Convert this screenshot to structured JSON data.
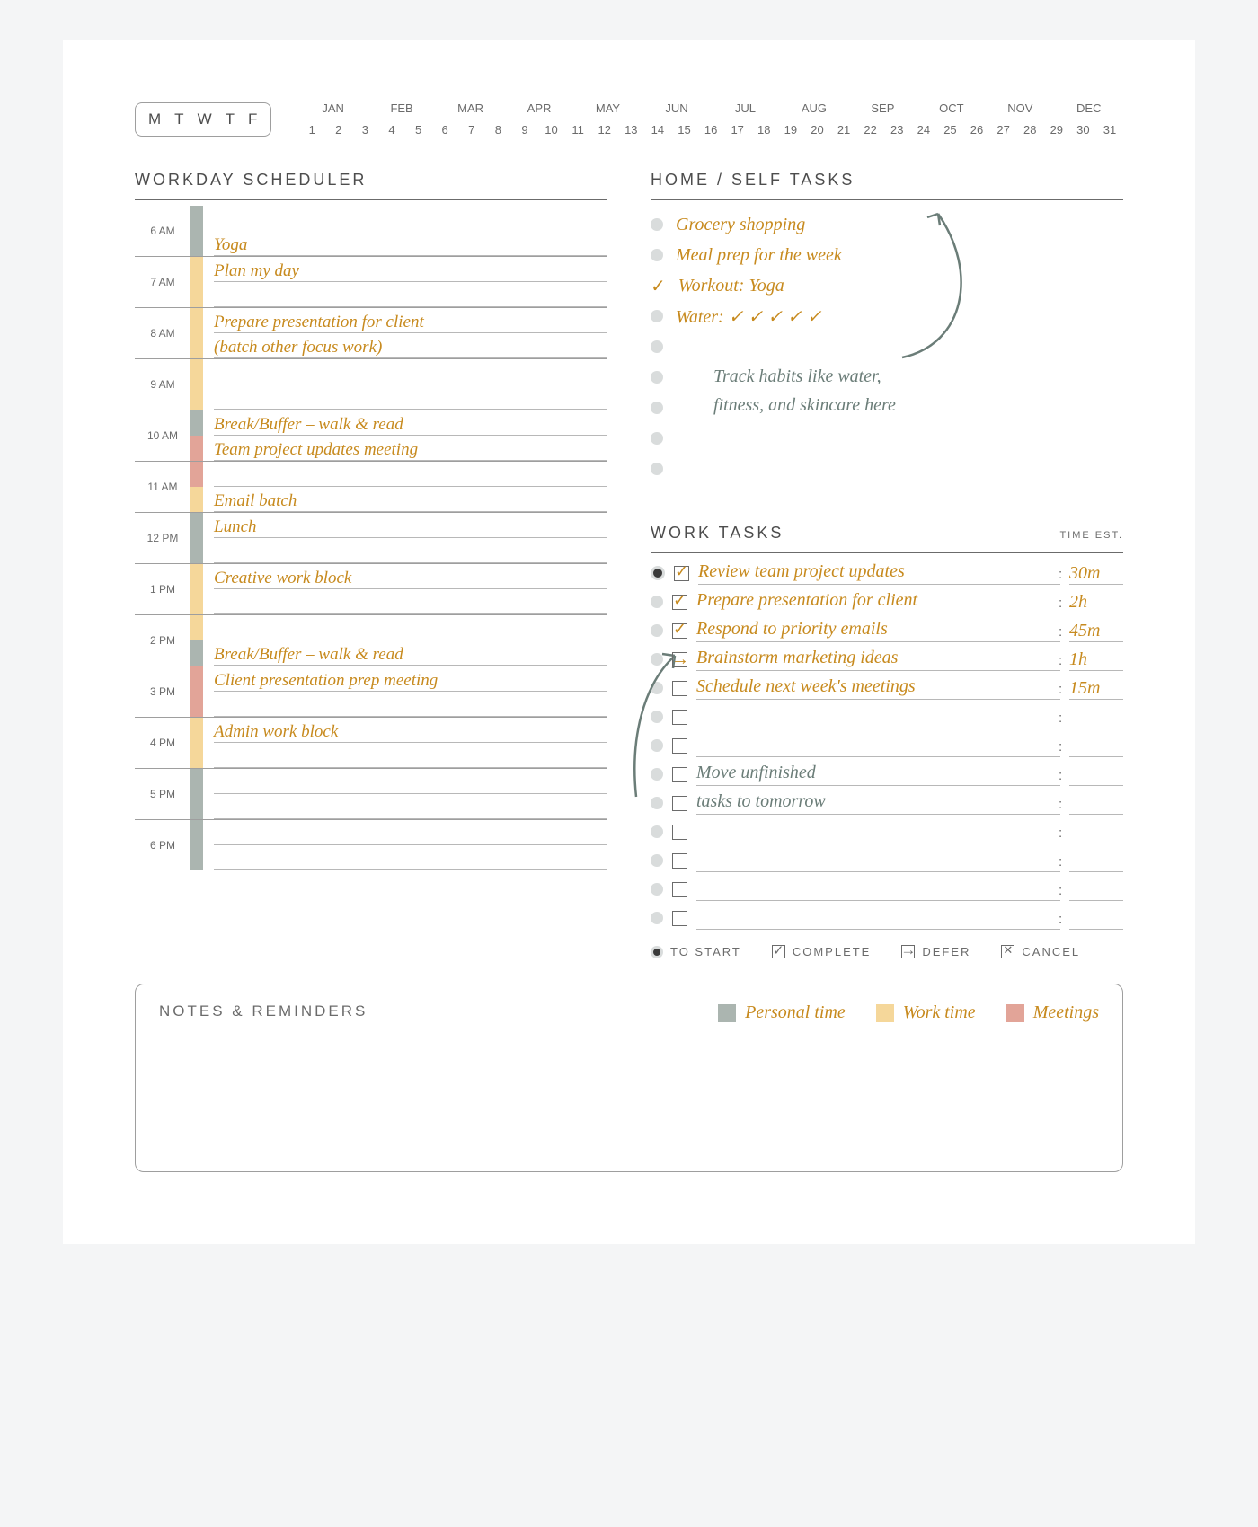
{
  "weekdays": [
    "M",
    "T",
    "W",
    "T",
    "F"
  ],
  "months": [
    "JAN",
    "FEB",
    "MAR",
    "APR",
    "MAY",
    "JUN",
    "JUL",
    "AUG",
    "SEP",
    "OCT",
    "NOV",
    "DEC"
  ],
  "days": [
    "1",
    "2",
    "3",
    "4",
    "5",
    "6",
    "7",
    "8",
    "9",
    "10",
    "11",
    "12",
    "13",
    "14",
    "15",
    "16",
    "17",
    "18",
    "19",
    "20",
    "21",
    "22",
    "23",
    "24",
    "25",
    "26",
    "27",
    "28",
    "29",
    "30",
    "31"
  ],
  "scheduler": {
    "title": "WORKDAY SCHEDULER",
    "hours": [
      {
        "label": "6 AM",
        "bars": [
          "g"
        ],
        "lines": [
          "Yoga"
        ],
        "single": true
      },
      {
        "label": "7 AM",
        "bars": [
          "s",
          "s"
        ],
        "lines": [
          "Plan my day",
          ""
        ]
      },
      {
        "label": "8 AM",
        "bars": [
          "s",
          "s"
        ],
        "lines": [
          "Prepare presentation for client",
          "(batch other focus work)"
        ]
      },
      {
        "label": "9 AM",
        "bars": [
          "s",
          "s"
        ],
        "lines": [
          "",
          ""
        ]
      },
      {
        "label": "10 AM",
        "bars": [
          "g",
          "r"
        ],
        "lines": [
          "Break/Buffer – walk & read",
          "Team project updates meeting"
        ]
      },
      {
        "label": "11 AM",
        "bars": [
          "r",
          "s"
        ],
        "lines": [
          "",
          "Email batch"
        ]
      },
      {
        "label": "12 PM",
        "bars": [
          "g",
          "g"
        ],
        "lines": [
          "Lunch",
          ""
        ]
      },
      {
        "label": "1 PM",
        "bars": [
          "s",
          "s"
        ],
        "lines": [
          "Creative work block",
          ""
        ]
      },
      {
        "label": "2 PM",
        "bars": [
          "s",
          "g"
        ],
        "lines": [
          "",
          "Break/Buffer – walk & read"
        ]
      },
      {
        "label": "3 PM",
        "bars": [
          "r",
          "r"
        ],
        "lines": [
          "Client presentation prep meeting",
          ""
        ]
      },
      {
        "label": "4 PM",
        "bars": [
          "s",
          "s"
        ],
        "lines": [
          "Admin work block",
          ""
        ]
      },
      {
        "label": "5 PM",
        "bars": [
          "g",
          "g"
        ],
        "lines": [
          "",
          ""
        ]
      },
      {
        "label": "6 PM",
        "bars": [
          "g",
          "g"
        ],
        "lines": [
          "",
          ""
        ]
      }
    ]
  },
  "home": {
    "title": "HOME / SELF TASKS",
    "items": [
      {
        "text": "Grocery shopping",
        "checked": false
      },
      {
        "text": "Meal prep for the week",
        "checked": false
      },
      {
        "text": "Workout: Yoga",
        "checked": true
      },
      {
        "text": "Water: ✓ ✓ ✓ ✓ ✓",
        "checked": false
      },
      {
        "text": "",
        "checked": false
      },
      {
        "text": "",
        "checked": false
      },
      {
        "text": "",
        "checked": false
      },
      {
        "text": "",
        "checked": false
      },
      {
        "text": "",
        "checked": false
      }
    ],
    "note": "Track habits like water, fitness, and skincare here"
  },
  "work": {
    "title": "WORK TASKS",
    "sub": "TIME EST.",
    "tasks": [
      {
        "status": "complete",
        "text": "Review team project updates",
        "est": "30m",
        "sel": true,
        "color": "gold"
      },
      {
        "status": "complete",
        "text": "Prepare presentation for client",
        "est": "2h",
        "sel": false,
        "color": "gold"
      },
      {
        "status": "complete",
        "text": "Respond to priority emails",
        "est": "45m",
        "sel": false,
        "color": "gold"
      },
      {
        "status": "defer",
        "text": "Brainstorm marketing ideas",
        "est": "1h",
        "sel": false,
        "color": "gold"
      },
      {
        "status": "",
        "text": "Schedule next week's meetings",
        "est": "15m",
        "sel": false,
        "color": "gold"
      },
      {
        "status": "",
        "text": "",
        "est": "",
        "sel": false,
        "color": ""
      },
      {
        "status": "",
        "text": "",
        "est": "",
        "sel": false,
        "color": ""
      },
      {
        "status": "",
        "text": "Move unfinished",
        "est": "",
        "sel": false,
        "color": "grey"
      },
      {
        "status": "",
        "text": "tasks to tomorrow",
        "est": "",
        "sel": false,
        "color": "grey"
      },
      {
        "status": "",
        "text": "",
        "est": "",
        "sel": false,
        "color": ""
      },
      {
        "status": "",
        "text": "",
        "est": "",
        "sel": false,
        "color": ""
      },
      {
        "status": "",
        "text": "",
        "est": "",
        "sel": false,
        "color": ""
      },
      {
        "status": "",
        "text": "",
        "est": "",
        "sel": false,
        "color": ""
      }
    ],
    "legend": {
      "start": "TO START",
      "complete": "COMPLETE",
      "defer": "DEFER",
      "cancel": "CANCEL"
    }
  },
  "notes": {
    "title": "NOTES & REMINDERS",
    "legend": [
      {
        "label": "Personal time",
        "color": "#abb5b0"
      },
      {
        "label": "Work time",
        "color": "#f5d79a"
      },
      {
        "label": "Meetings",
        "color": "#e2a498"
      }
    ]
  }
}
